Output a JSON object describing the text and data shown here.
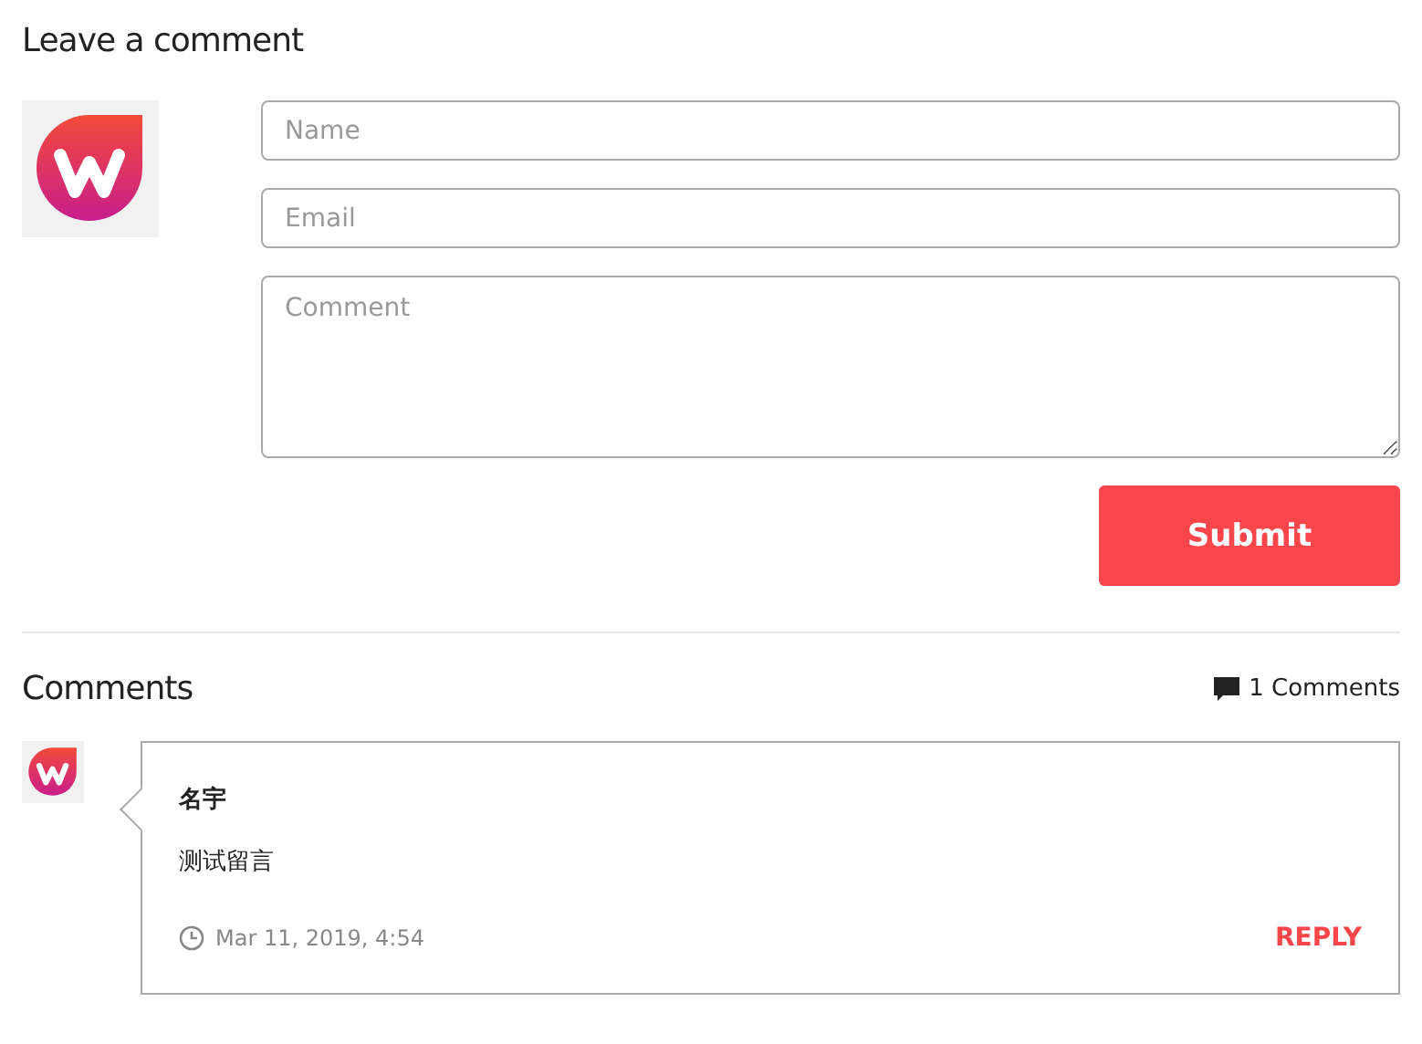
{
  "form": {
    "title": "Leave a comment",
    "fields": [
      {
        "kind": "input",
        "placeholder": "Name"
      },
      {
        "kind": "input",
        "placeholder": "Email"
      },
      {
        "kind": "textarea",
        "placeholder": "Comment"
      }
    ],
    "submit": "Submit"
  },
  "comments_section": {
    "title": "Comments",
    "count": "1 Comments",
    "comments": [
      {
        "author": "名宇",
        "text": "测试留言",
        "date": "Mar 11, 2019, 4:54",
        "reply": "REPLY"
      }
    ]
  }
}
